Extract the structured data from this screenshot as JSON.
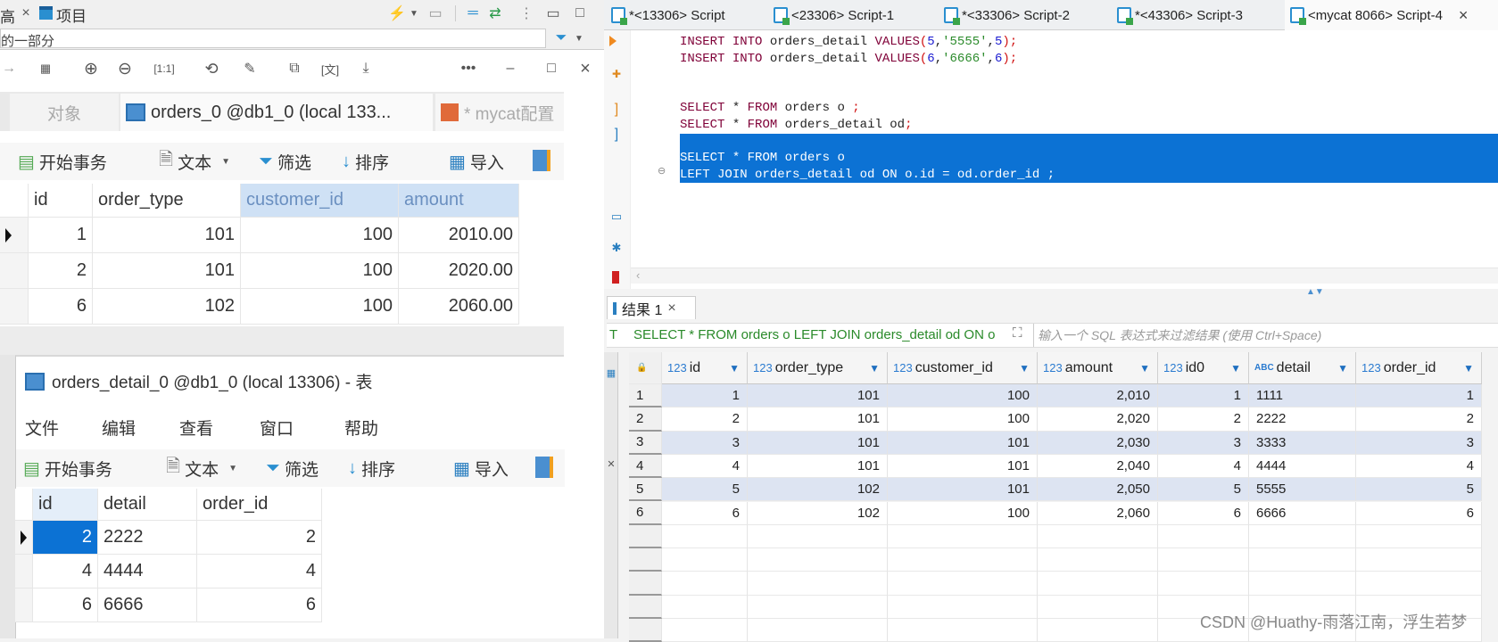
{
  "left_panel": {
    "tab_fragment": "高",
    "project_label": "项目",
    "search_fragment": "的一部分"
  },
  "upper_window": {
    "tabs": [
      "对象",
      "orders_0 @db1_0 (local 133...",
      "* mycat配置"
    ],
    "toolbar": {
      "begin": "开始事务",
      "text": "文本",
      "filter": "筛选",
      "sort": "排序",
      "import": "导入"
    },
    "columns": [
      "id",
      "order_type",
      "customer_id",
      "amount"
    ],
    "rows": [
      [
        "1",
        "101",
        "100",
        "2010.00"
      ],
      [
        "2",
        "101",
        "100",
        "2020.00"
      ],
      [
        "6",
        "102",
        "100",
        "2060.00"
      ]
    ]
  },
  "lower_window": {
    "title": "orders_detail_0 @db1_0 (local 13306) - 表",
    "menu": [
      "文件",
      "编辑",
      "查看",
      "窗口",
      "帮助"
    ],
    "toolbar": {
      "begin": "开始事务",
      "text": "文本",
      "filter": "筛选",
      "sort": "排序",
      "import": "导入"
    },
    "columns": [
      "id",
      "detail",
      "order_id"
    ],
    "rows": [
      [
        "2",
        "2222",
        "2"
      ],
      [
        "4",
        "4444",
        "4"
      ],
      [
        "6",
        "6666",
        "6"
      ]
    ]
  },
  "editor": {
    "tabs": [
      "*<13306> Script",
      "<23306> Script-1",
      "*<33306> Script-2",
      "*<43306> Script-3",
      "<mycat 8066> Script-4"
    ],
    "active_tab": 4,
    "lines": [
      "INSERT INTO orders_detail VALUES(5,'5555',5);",
      "INSERT INTO orders_detail VALUES(6,'6666',6);",
      "",
      "",
      "SELECT * FROM orders o ;",
      "SELECT * FROM orders_detail od;",
      "",
      "SELECT * FROM orders o",
      "LEFT JOIN orders_detail od ON o.id = od.order_id ;"
    ],
    "selected_lines": [
      6,
      7,
      8
    ]
  },
  "results": {
    "tab_label": "结果 1",
    "query": "SELECT * FROM orders o LEFT JOIN orders_detail od ON o",
    "filter_placeholder": "输入一个 SQL 表达式来过滤结果 (使用 Ctrl+Space)",
    "columns": [
      {
        "type": "123",
        "name": "id"
      },
      {
        "type": "123",
        "name": "order_type"
      },
      {
        "type": "123",
        "name": "customer_id"
      },
      {
        "type": "123",
        "name": "amount"
      },
      {
        "type": "123",
        "name": "id0"
      },
      {
        "type": "ABC",
        "name": "detail"
      },
      {
        "type": "123",
        "name": "order_id"
      }
    ],
    "rows": [
      [
        "1",
        "101",
        "100",
        "2,010",
        "1",
        "1111",
        "1"
      ],
      [
        "2",
        "101",
        "100",
        "2,020",
        "2",
        "2222",
        "2"
      ],
      [
        "3",
        "101",
        "101",
        "2,030",
        "3",
        "3333",
        "3"
      ],
      [
        "4",
        "101",
        "101",
        "2,040",
        "4",
        "4444",
        "4"
      ],
      [
        "5",
        "102",
        "101",
        "2,050",
        "5",
        "5555",
        "5"
      ],
      [
        "6",
        "102",
        "100",
        "2,060",
        "6",
        "6666",
        "6"
      ]
    ]
  },
  "watermark": "CSDN @Huathy-雨落江南，浮生若梦",
  "colors": {
    "selection": "#0c72d4",
    "row_alt": "#dde4f2",
    "keyword": "#7f0037"
  }
}
